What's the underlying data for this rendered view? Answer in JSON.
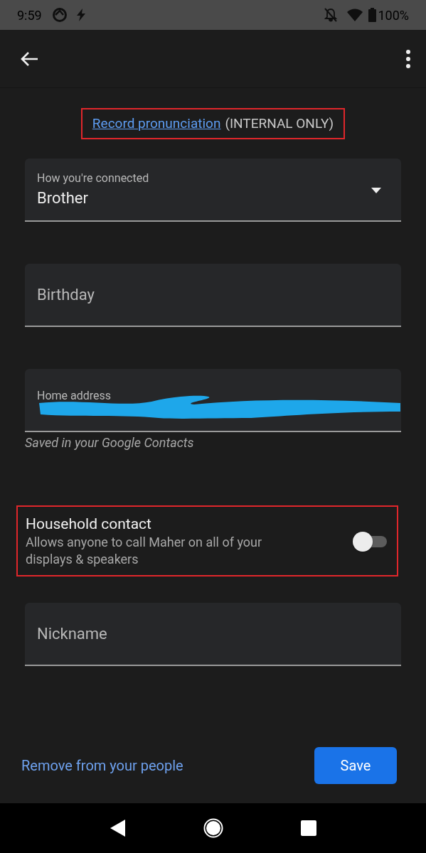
{
  "status_bar": {
    "time": "9:59",
    "battery": "100%"
  },
  "record": {
    "link": "Record pronunciation",
    "note": "(INTERNAL ONLY)",
    "highlighted": true
  },
  "fields": [
    {
      "kind": "dropdown",
      "label": "How you're connected",
      "value": "Brother"
    },
    {
      "kind": "empty",
      "placeholder": "Birthday"
    },
    {
      "kind": "redacted",
      "label": "Home address",
      "helper": "Saved in your Google Contacts"
    }
  ],
  "household": {
    "title": "Household contact",
    "description": "Allows anyone to call Maher on all of your displays & speakers",
    "on": false,
    "highlighted": true
  },
  "nickname": {
    "placeholder": "Nickname"
  },
  "footer": {
    "link": "Remove from your people",
    "button": "Save"
  }
}
